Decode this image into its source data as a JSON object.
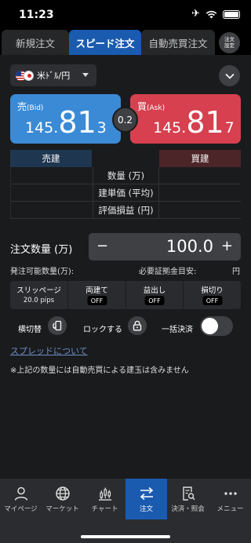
{
  "status": {
    "time": "11:23"
  },
  "tabs": [
    {
      "label": "新規注文"
    },
    {
      "label": "スピード注文"
    },
    {
      "label": "自動売買注文"
    }
  ],
  "settings": {
    "line1": "注文",
    "line2": "設定"
  },
  "pair": {
    "label": "米ﾄﾞﾙ/円"
  },
  "bid": {
    "label": "売",
    "sub": "(Bid)",
    "small": "145.",
    "big": "81",
    "pip": "3"
  },
  "ask": {
    "label": "買",
    "sub": "(Ask)",
    "small": "145.",
    "big": "81",
    "pip": "7"
  },
  "spread": {
    "value": "0.2"
  },
  "positions": {
    "sell_header": "売建",
    "buy_header": "買建",
    "rows": [
      {
        "label": "数量 (万)"
      },
      {
        "label": "建単価 (平均)"
      },
      {
        "label": "評価損益 (円)"
      }
    ]
  },
  "quantity": {
    "label": "注文数量 (万)",
    "value": "100.0",
    "minus": "−",
    "plus": "+"
  },
  "info": {
    "available": "発注可能数量(万):",
    "margin": "必要証拠金目安:",
    "margin_unit": "円"
  },
  "options": [
    {
      "title": "スリッページ",
      "value": "20.0 pips"
    },
    {
      "title": "両建て",
      "value": "OFF"
    },
    {
      "title": "益出し",
      "value": "OFF"
    },
    {
      "title": "損切り",
      "value": "OFF"
    }
  ],
  "controls": {
    "rotate_label": "横切替",
    "lock_label": "ロックする",
    "bulk_label": "一括決済",
    "bulk_on": false
  },
  "spread_link": "スプレッドについて",
  "note": "※上記の数量には自動売買による建玉は含みません",
  "nav": [
    {
      "label": "マイページ",
      "icon": "person-icon"
    },
    {
      "label": "マーケット",
      "icon": "globe-icon"
    },
    {
      "label": "チャート",
      "icon": "chart-icon"
    },
    {
      "label": "注文",
      "icon": "transfer-arrows-icon"
    },
    {
      "label": "決済・照会",
      "icon": "document-search-icon"
    },
    {
      "label": "メニュー",
      "icon": "more-dots-icon"
    }
  ],
  "colors": {
    "bid": "#3a8ad6",
    "ask": "#d6404f",
    "accent": "#1a5bb0"
  }
}
